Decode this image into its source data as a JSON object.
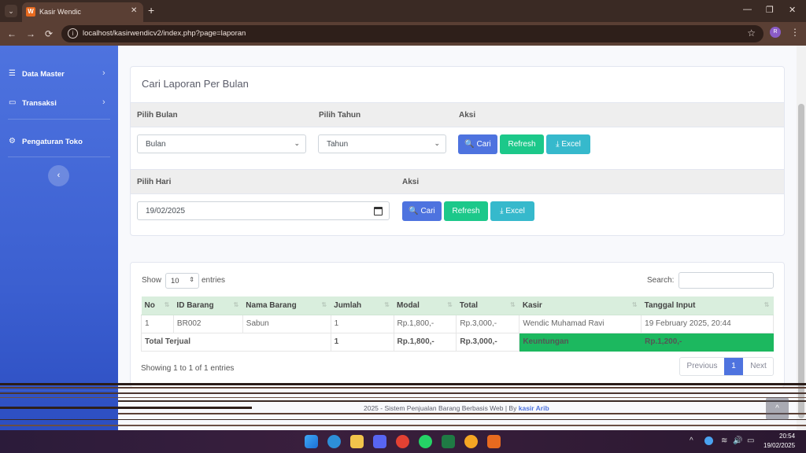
{
  "browser": {
    "tab_title": "Kasir Wendic",
    "favicon_letter": "W",
    "url": "localhost/kasirwendicv2/index.php?page=laporan",
    "profile_initial": "R",
    "glyphs": {
      "tab_menu": "⌄",
      "close": "✕",
      "new_tab": "+",
      "minimize": "—",
      "restore": "❐",
      "back": "←",
      "forward": "→",
      "reload": "⟳",
      "info": "i",
      "star": "☆",
      "kebab": "⋮"
    }
  },
  "sidebar": {
    "items": [
      {
        "label": "Data Master",
        "icon": "database-icon",
        "glyph": "☰",
        "chevron": "›"
      },
      {
        "label": "Transaksi",
        "icon": "desktop-icon",
        "glyph": "▭",
        "chevron": "›"
      },
      {
        "label": "Pengaturan Toko",
        "icon": "cogs-icon",
        "glyph": "⚙"
      }
    ],
    "toggle_glyph": "‹"
  },
  "monthly": {
    "title": "Cari Laporan Per Bulan",
    "month_label": "Pilih Bulan",
    "year_label": "Pilih Tahun",
    "action_label": "Aksi",
    "month_value": "Bulan",
    "year_value": "Tahun",
    "search_btn": "Cari",
    "refresh_btn": "Refresh",
    "excel_btn": "Excel",
    "caret": "⌄"
  },
  "daily": {
    "day_label": "Pilih Hari",
    "action_label": "Aksi",
    "date_value": "19/02/2025",
    "search_btn": "Cari",
    "refresh_btn": "Refresh",
    "excel_btn": "Excel"
  },
  "glyphs": {
    "search": "🔍",
    "download": "⤓",
    "sort": "⇅"
  },
  "table": {
    "show_label": "Show",
    "page_length": "10",
    "length_caret": "⇕",
    "entries_label": "entries",
    "search_label": "Search:",
    "columns": [
      "No",
      "ID Barang",
      "Nama Barang",
      "Jumlah",
      "Modal",
      "Total",
      "Kasir",
      "Tanggal Input"
    ],
    "rows": [
      [
        "1",
        "BR002",
        "Sabun",
        "1",
        "Rp.1,800,-",
        "Rp.3,000,-",
        "Wendic Muhamad Ravi",
        "19 February 2025, 20:44"
      ]
    ],
    "footer": {
      "label": "Total Terjual",
      "jumlah": "1",
      "modal": "Rp.1,800,-",
      "total": "Rp.3,000,-",
      "profit_label": "Keuntungan",
      "profit_value": "Rp.1,200,-"
    },
    "info": "Showing 1 to 1 of 1 entries",
    "pagination": {
      "prev": "Previous",
      "current": "1",
      "next": "Next"
    }
  },
  "footer": {
    "text": "2025 - Sistem Penjualan Barang Berbasis Web | By",
    "author": "kasir Arib",
    "scroll_top_glyph": "^"
  },
  "taskbar": {
    "time": "20:54",
    "date": "19/02/2025",
    "tray_glyphs": {
      "chevron": "^",
      "wifi": "≋",
      "volume": "🔊",
      "battery": "▭"
    }
  }
}
